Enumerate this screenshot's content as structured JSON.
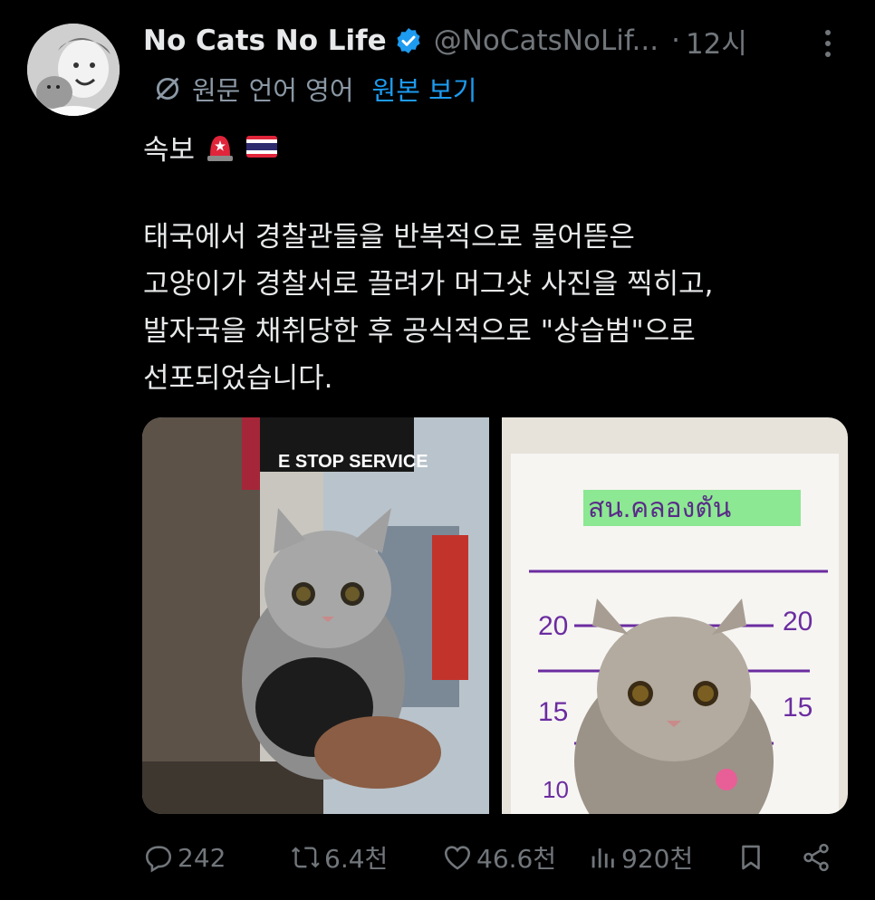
{
  "author": {
    "display_name": "No Cats No Life",
    "handle": "@NoCatsNoLif...",
    "separator": "·",
    "time": "12시"
  },
  "translation": {
    "source_label": "원문 언어 영어",
    "show_original_label": "원본 보기"
  },
  "post": {
    "headline": "속보",
    "body": "태국에서 경찰관들을 반복적으로 물어뜯은\n고양이가 경찰서로 끌려가 머그샷 사진을 찍히고,\n발자국을 채취당한 후 공식적으로 \"상습범\"으로\n선포되었습니다."
  },
  "media": {
    "left_sign_text": "E STOP SERVICE",
    "right_sign_text": "สน.คลองตัน",
    "height_marks": [
      "20",
      "20",
      "15",
      "15",
      "10"
    ]
  },
  "metrics": {
    "replies": "242",
    "reposts": "6.4천",
    "likes": "46.6천",
    "views": "920천"
  },
  "colors": {
    "accent": "#1d9bf0",
    "muted": "#71767b",
    "text": "#e7e9ea"
  }
}
